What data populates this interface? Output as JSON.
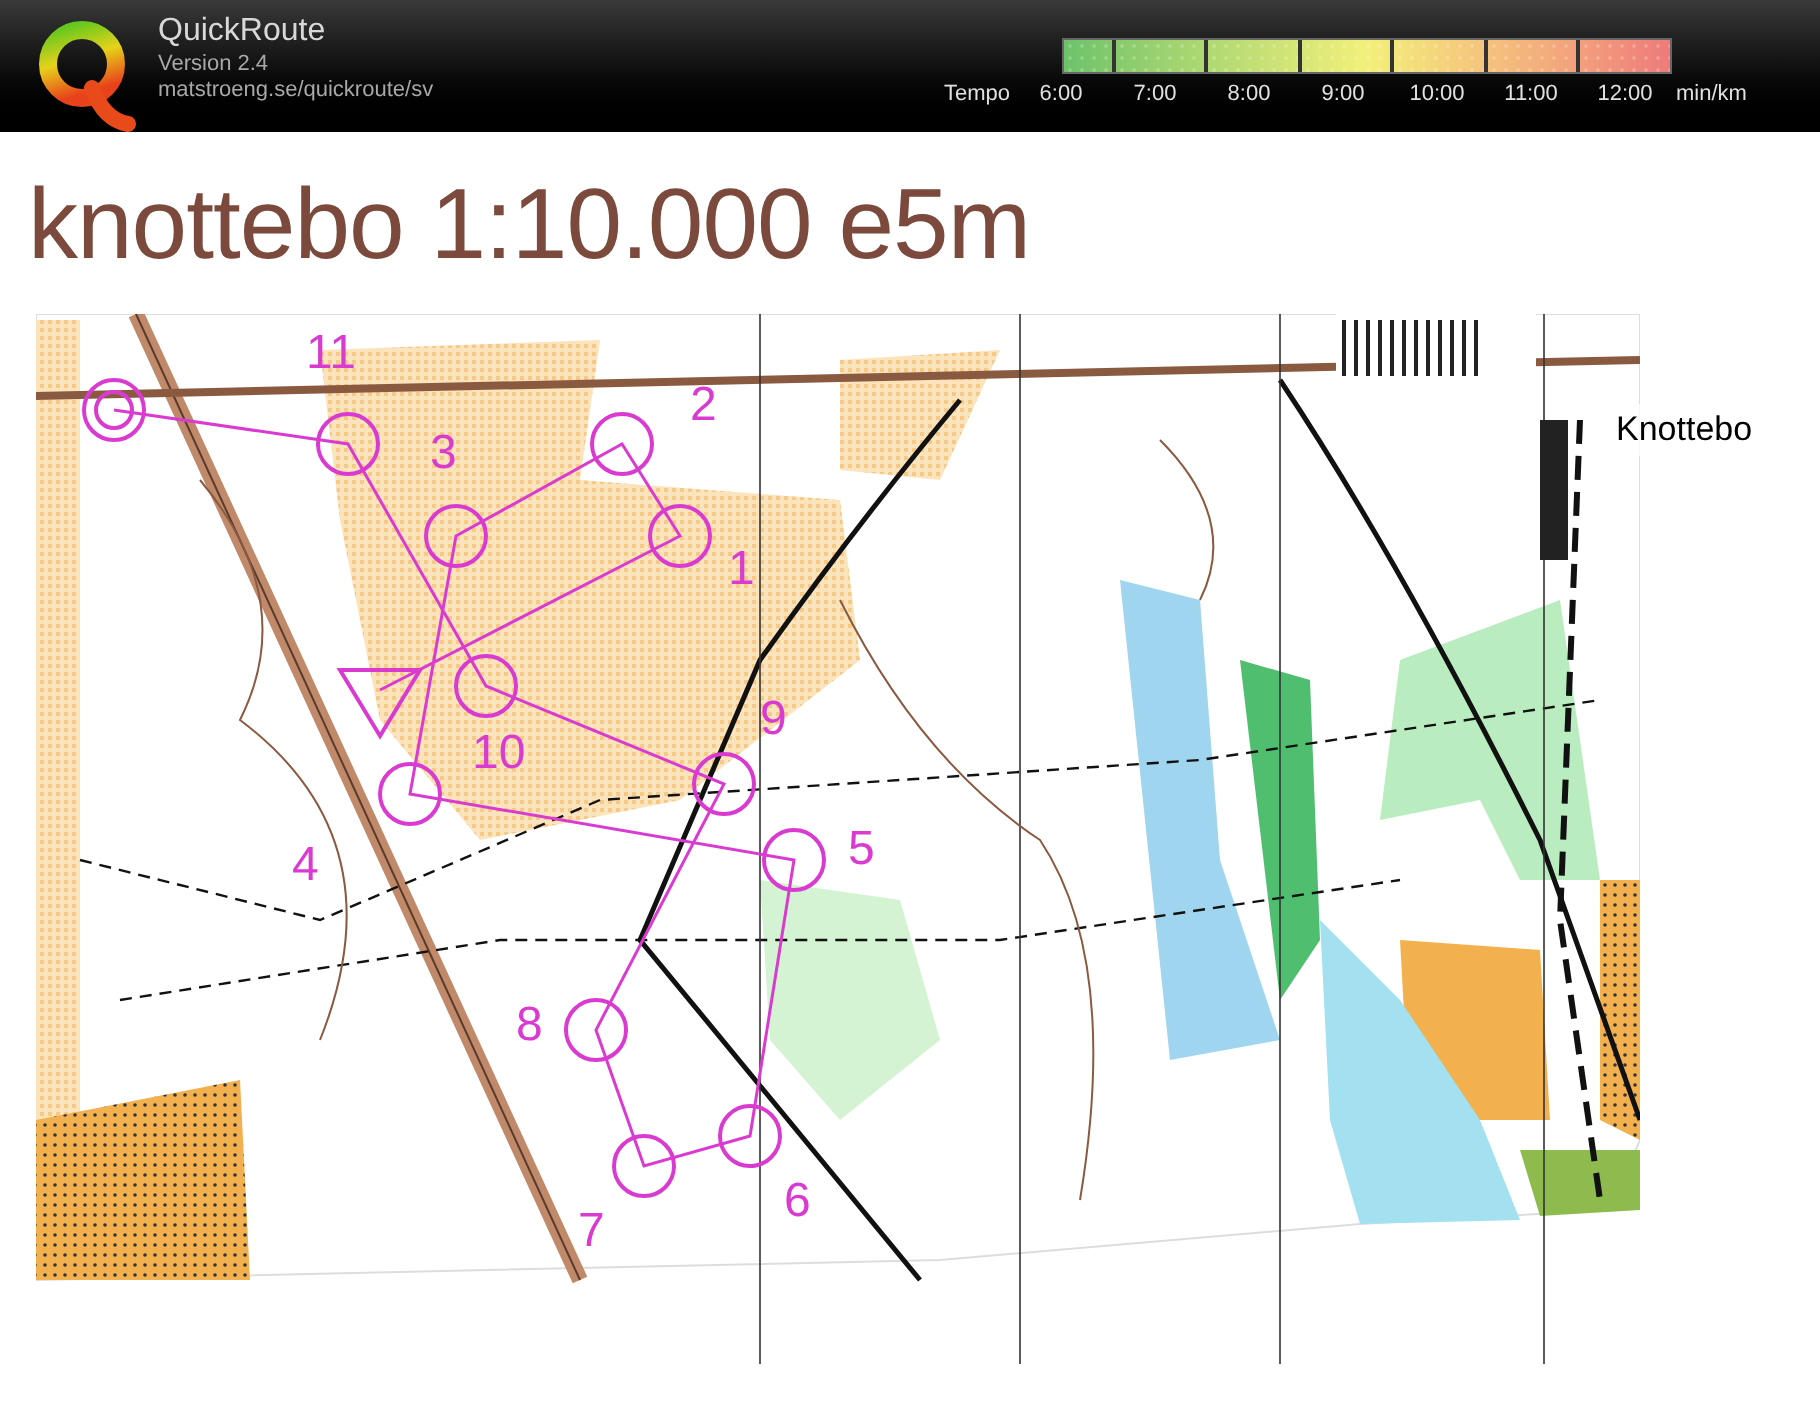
{
  "app": {
    "name": "QuickRoute",
    "version": "Version 2.4",
    "url": "matstroeng.se/quickroute/sv"
  },
  "tempo_legend": {
    "label": "Tempo",
    "ticks": [
      "6:00",
      "7:00",
      "8:00",
      "9:00",
      "10:00",
      "11:00",
      "12:00"
    ],
    "unit": "min/km"
  },
  "map": {
    "title": "knottebo 1:10.000 e5m",
    "place_label": "Knottebo",
    "controls": [
      {
        "number": "1"
      },
      {
        "number": "2"
      },
      {
        "number": "3"
      },
      {
        "number": "4"
      },
      {
        "number": "5"
      },
      {
        "number": "6"
      },
      {
        "number": "7"
      },
      {
        "number": "8"
      },
      {
        "number": "9"
      },
      {
        "number": "10"
      },
      {
        "number": "11"
      }
    ]
  }
}
